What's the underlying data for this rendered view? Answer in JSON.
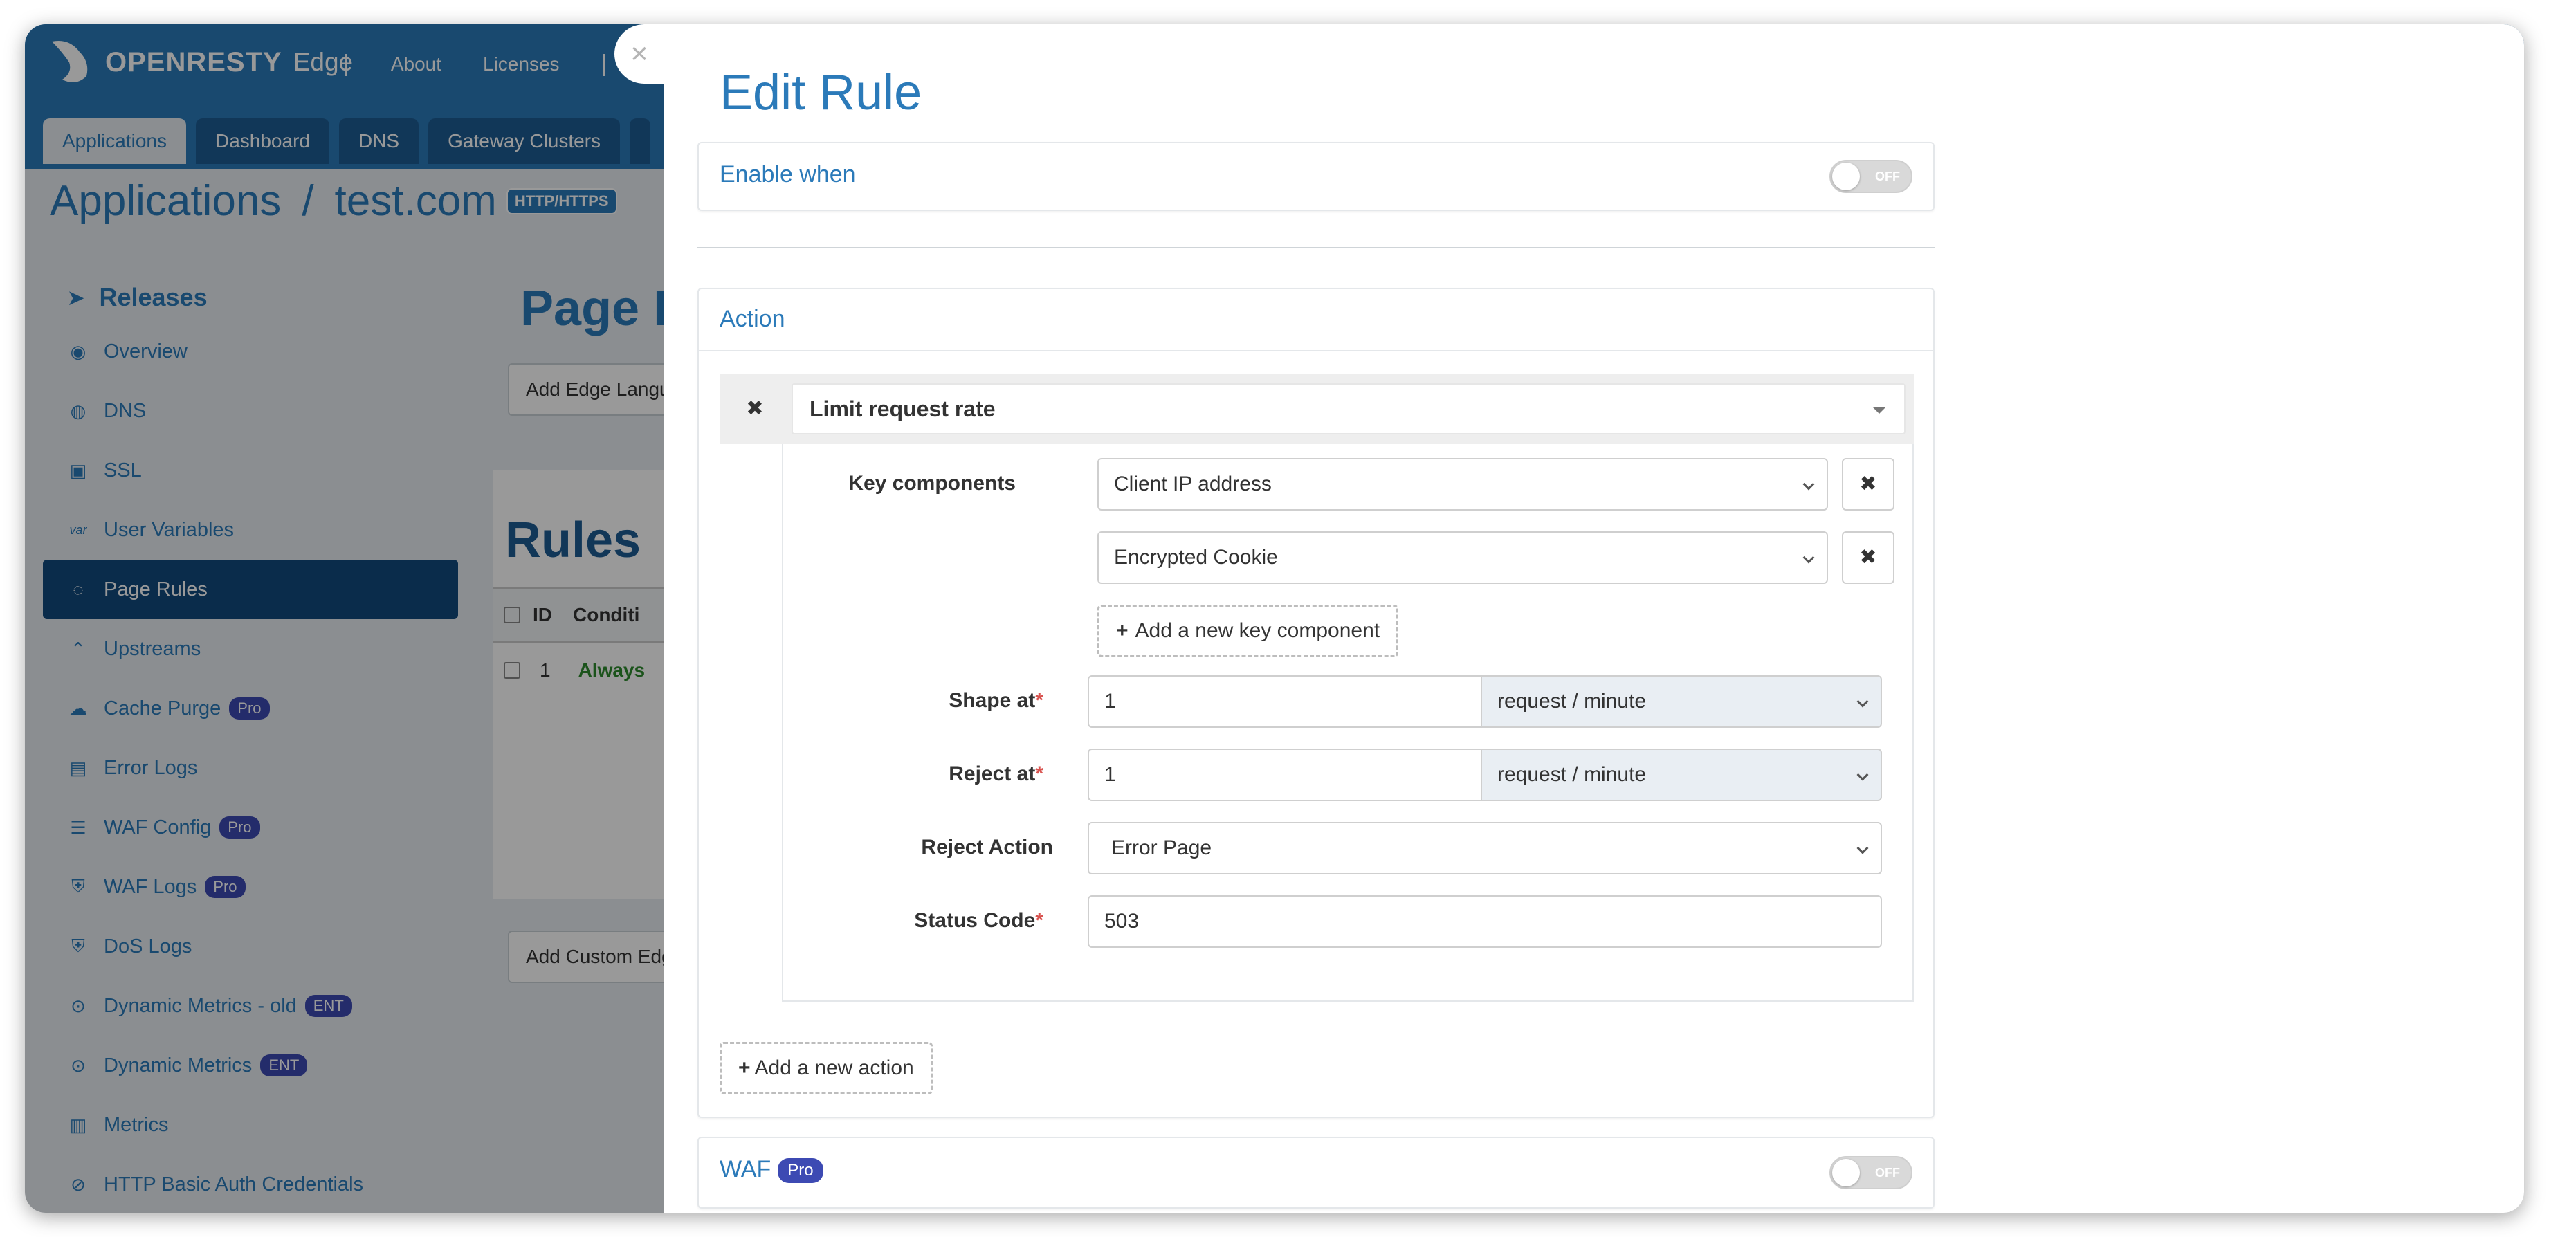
{
  "app": {
    "logo_text": "OPENRESTY",
    "logo_suffix": "Edge",
    "top_nav": [
      "About",
      "Licenses"
    ],
    "tabs": [
      "Applications",
      "Dashboard",
      "DNS",
      "Gateway Clusters"
    ],
    "breadcrumb": {
      "root": "Applications",
      "sep": "/",
      "current": "test.com",
      "badge": "HTTP/HTTPS"
    }
  },
  "sidebar": {
    "heading": "Releases",
    "items": [
      {
        "label": "Overview",
        "icon": "dashboard-icon"
      },
      {
        "label": "DNS",
        "icon": "globe-icon"
      },
      {
        "label": "SSL",
        "icon": "certificate-icon"
      },
      {
        "label": "User Variables",
        "icon": "var-icon"
      },
      {
        "label": "Page Rules",
        "icon": "page-rules-icon",
        "active": true
      },
      {
        "label": "Upstreams",
        "icon": "upstreams-icon"
      },
      {
        "label": "Cache Purge",
        "icon": "cloud-icon",
        "badge": "Pro"
      },
      {
        "label": "Error Logs",
        "icon": "log-icon"
      },
      {
        "label": "WAF Config",
        "icon": "list-icon",
        "badge": "Pro"
      },
      {
        "label": "WAF Logs",
        "icon": "shield-log-icon",
        "badge": "Pro"
      },
      {
        "label": "DoS Logs",
        "icon": "shield-log-icon"
      },
      {
        "label": "Dynamic Metrics - old",
        "icon": "pin-icon",
        "badge": "ENT"
      },
      {
        "label": "Dynamic Metrics",
        "icon": "pin-icon",
        "badge": "ENT"
      },
      {
        "label": "Metrics",
        "icon": "bar-chart-icon"
      },
      {
        "label": "HTTP Basic Auth Credentials",
        "icon": "lock-icon"
      }
    ]
  },
  "main": {
    "title": "Page R",
    "add_lang_button": "Add Edge Langu",
    "rules_title": "Rules",
    "table_headers": [
      "ID",
      "Conditi"
    ],
    "row": {
      "id": "1",
      "condition": "Always"
    },
    "add_custom_button": "Add Custom Edg"
  },
  "modal": {
    "title": "Edit Rule",
    "close": "×",
    "enable_when": {
      "label": "Enable when",
      "toggle": "OFF"
    },
    "action": {
      "label": "Action",
      "rule_remove": "✖",
      "rule_name": "Limit request rate",
      "key_components_label": "Key components",
      "key_components": [
        "Client IP address",
        "Encrypted Cookie"
      ],
      "remove_key": "✖",
      "add_key_component": "Add a new key component",
      "shape_at": {
        "label": "Shape at",
        "value": "1",
        "unit": "request / minute"
      },
      "reject_at": {
        "label": "Reject at",
        "value": "1",
        "unit": "request / minute"
      },
      "reject_action": {
        "label": "Reject Action",
        "value": "Error Page"
      },
      "status_code": {
        "label": "Status Code",
        "value": "503"
      },
      "add_action": "Add a new action"
    },
    "waf": {
      "label": "WAF",
      "badge": "Pro",
      "toggle": "OFF"
    }
  }
}
